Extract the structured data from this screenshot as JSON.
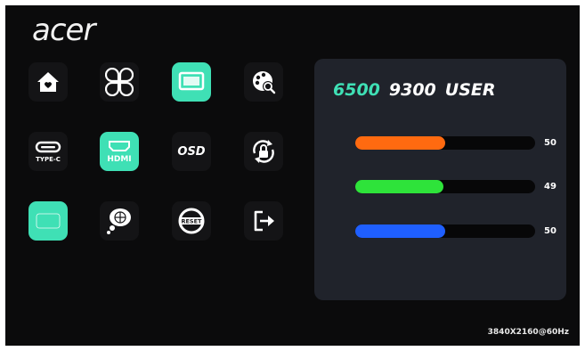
{
  "brand": {
    "logo_text": "acer"
  },
  "menu": {
    "items": [
      {
        "name": "home",
        "icon": "home-icon",
        "active": false
      },
      {
        "name": "layout",
        "icon": "four-petal-icon",
        "active": false
      },
      {
        "name": "display",
        "icon": "display-icon",
        "active": true
      },
      {
        "name": "color",
        "icon": "palette-icon",
        "active": false
      },
      {
        "name": "type-c",
        "icon": "type-c-icon",
        "label": "TYPE-C",
        "active": false
      },
      {
        "name": "hdmi",
        "icon": "hdmi-icon",
        "label": "HDMI",
        "active": false
      },
      {
        "name": "osd",
        "icon": "osd-icon",
        "label": "OSD",
        "active": false
      },
      {
        "name": "lock",
        "icon": "rotate-lock-icon",
        "active": false
      },
      {
        "name": "input",
        "icon": "input-box-icon",
        "active": false
      },
      {
        "name": "language",
        "icon": "globe-chat-icon",
        "active": false
      },
      {
        "name": "reset",
        "icon": "reset-icon",
        "label": "RESET",
        "active": false
      },
      {
        "name": "exit",
        "icon": "exit-icon",
        "active": false
      }
    ],
    "accent_color": "#3fe0b5"
  },
  "color_temp": {
    "options": [
      "6500",
      "9300",
      "USER"
    ],
    "selected": "6500"
  },
  "rgb": {
    "red": {
      "value": "50",
      "level": 0.5,
      "color": "#ff6a10"
    },
    "green": {
      "value": "49",
      "level": 0.49,
      "color": "#2ee33a"
    },
    "blue": {
      "value": "50",
      "level": 0.5,
      "color": "#1f5fff"
    }
  },
  "status": {
    "resolution": "3840X2160@60Hz"
  }
}
